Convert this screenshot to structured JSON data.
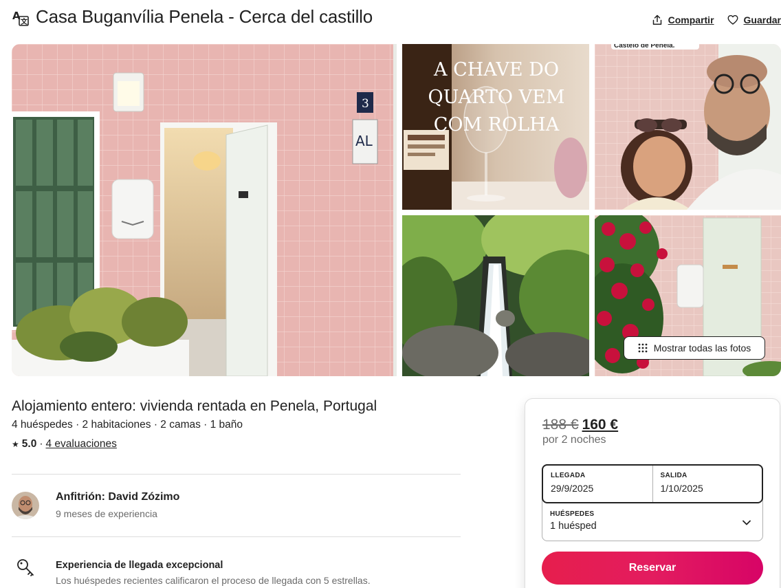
{
  "header": {
    "title": "Casa Buganvília Penela - Cerca del castillo",
    "share_label": "Compartir",
    "save_label": "Guardar",
    "icons": {
      "translate": "translate-icon",
      "share": "share-icon",
      "save": "heart-icon"
    }
  },
  "gallery": {
    "photos": [
      {
        "name": "photo-entrance-door"
      },
      {
        "name": "photo-wine-glass",
        "overlay_text": [
          "A CHAVE DO",
          "QUARTO VEM",
          "COM ROLHA"
        ]
      },
      {
        "name": "photo-couple-selfie",
        "overlay_text": "Castelo de Penela."
      },
      {
        "name": "photo-waterfall"
      },
      {
        "name": "photo-bougainvillea-door"
      }
    ],
    "show_all_label": "Mostrar todas las fotos"
  },
  "listing": {
    "type_title": "Alojamiento entero: vivienda rentada en Penela, Portugal",
    "details": "4 huéspedes · 2 habitaciones · 2 camas · 1 baño",
    "rating_star": "★",
    "rating_value": "5.0",
    "rating_sep": "·",
    "reviews_label": "4 evaluaciones"
  },
  "host": {
    "name_label": "Anfitrión: David Zózimo",
    "experience": "9 meses de experiencia"
  },
  "highlights": [
    {
      "icon": "key-icon",
      "title": "Experiencia de llegada excepcional",
      "description": "Los huéspedes recientes calificaron el proceso de llegada con 5 estrellas."
    }
  ],
  "booking": {
    "price_original": "188 €",
    "price_current": "160 €",
    "price_period": "por 2 noches",
    "checkin_label": "LLEGADA",
    "checkin_value": "29/9/2025",
    "checkout_label": "SALIDA",
    "checkout_value": "1/10/2025",
    "guests_label": "HUÉSPEDES",
    "guests_value": "1 huésped",
    "reserve_label": "Reservar"
  },
  "colors": {
    "brand": "#e31c5f",
    "text": "#222222",
    "muted": "#6a6a6a",
    "border": "#dddddd"
  }
}
